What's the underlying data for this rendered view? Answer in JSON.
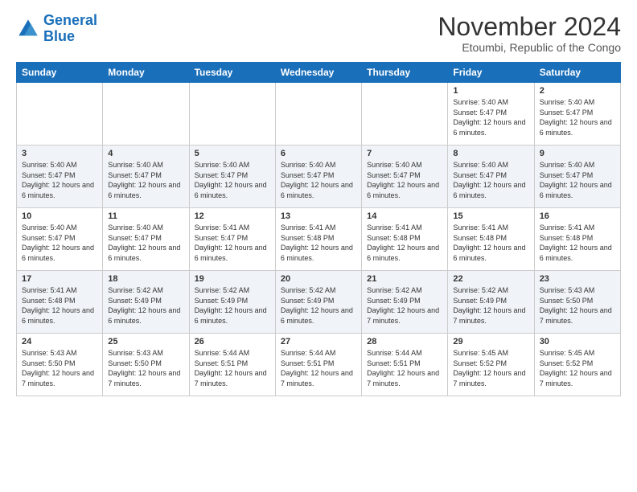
{
  "logo": {
    "line1": "General",
    "line2": "Blue"
  },
  "title": "November 2024",
  "location": "Etoumbi, Republic of the Congo",
  "days_of_week": [
    "Sunday",
    "Monday",
    "Tuesday",
    "Wednesday",
    "Thursday",
    "Friday",
    "Saturday"
  ],
  "weeks": [
    [
      {
        "day": "",
        "sunrise": "",
        "sunset": "",
        "daylight": ""
      },
      {
        "day": "",
        "sunrise": "",
        "sunset": "",
        "daylight": ""
      },
      {
        "day": "",
        "sunrise": "",
        "sunset": "",
        "daylight": ""
      },
      {
        "day": "",
        "sunrise": "",
        "sunset": "",
        "daylight": ""
      },
      {
        "day": "",
        "sunrise": "",
        "sunset": "",
        "daylight": ""
      },
      {
        "day": "1",
        "sunrise": "Sunrise: 5:40 AM",
        "sunset": "Sunset: 5:47 PM",
        "daylight": "Daylight: 12 hours and 6 minutes."
      },
      {
        "day": "2",
        "sunrise": "Sunrise: 5:40 AM",
        "sunset": "Sunset: 5:47 PM",
        "daylight": "Daylight: 12 hours and 6 minutes."
      }
    ],
    [
      {
        "day": "3",
        "sunrise": "Sunrise: 5:40 AM",
        "sunset": "Sunset: 5:47 PM",
        "daylight": "Daylight: 12 hours and 6 minutes."
      },
      {
        "day": "4",
        "sunrise": "Sunrise: 5:40 AM",
        "sunset": "Sunset: 5:47 PM",
        "daylight": "Daylight: 12 hours and 6 minutes."
      },
      {
        "day": "5",
        "sunrise": "Sunrise: 5:40 AM",
        "sunset": "Sunset: 5:47 PM",
        "daylight": "Daylight: 12 hours and 6 minutes."
      },
      {
        "day": "6",
        "sunrise": "Sunrise: 5:40 AM",
        "sunset": "Sunset: 5:47 PM",
        "daylight": "Daylight: 12 hours and 6 minutes."
      },
      {
        "day": "7",
        "sunrise": "Sunrise: 5:40 AM",
        "sunset": "Sunset: 5:47 PM",
        "daylight": "Daylight: 12 hours and 6 minutes."
      },
      {
        "day": "8",
        "sunrise": "Sunrise: 5:40 AM",
        "sunset": "Sunset: 5:47 PM",
        "daylight": "Daylight: 12 hours and 6 minutes."
      },
      {
        "day": "9",
        "sunrise": "Sunrise: 5:40 AM",
        "sunset": "Sunset: 5:47 PM",
        "daylight": "Daylight: 12 hours and 6 minutes."
      }
    ],
    [
      {
        "day": "10",
        "sunrise": "Sunrise: 5:40 AM",
        "sunset": "Sunset: 5:47 PM",
        "daylight": "Daylight: 12 hours and 6 minutes."
      },
      {
        "day": "11",
        "sunrise": "Sunrise: 5:40 AM",
        "sunset": "Sunset: 5:47 PM",
        "daylight": "Daylight: 12 hours and 6 minutes."
      },
      {
        "day": "12",
        "sunrise": "Sunrise: 5:41 AM",
        "sunset": "Sunset: 5:47 PM",
        "daylight": "Daylight: 12 hours and 6 minutes."
      },
      {
        "day": "13",
        "sunrise": "Sunrise: 5:41 AM",
        "sunset": "Sunset: 5:48 PM",
        "daylight": "Daylight: 12 hours and 6 minutes."
      },
      {
        "day": "14",
        "sunrise": "Sunrise: 5:41 AM",
        "sunset": "Sunset: 5:48 PM",
        "daylight": "Daylight: 12 hours and 6 minutes."
      },
      {
        "day": "15",
        "sunrise": "Sunrise: 5:41 AM",
        "sunset": "Sunset: 5:48 PM",
        "daylight": "Daylight: 12 hours and 6 minutes."
      },
      {
        "day": "16",
        "sunrise": "Sunrise: 5:41 AM",
        "sunset": "Sunset: 5:48 PM",
        "daylight": "Daylight: 12 hours and 6 minutes."
      }
    ],
    [
      {
        "day": "17",
        "sunrise": "Sunrise: 5:41 AM",
        "sunset": "Sunset: 5:48 PM",
        "daylight": "Daylight: 12 hours and 6 minutes."
      },
      {
        "day": "18",
        "sunrise": "Sunrise: 5:42 AM",
        "sunset": "Sunset: 5:49 PM",
        "daylight": "Daylight: 12 hours and 6 minutes."
      },
      {
        "day": "19",
        "sunrise": "Sunrise: 5:42 AM",
        "sunset": "Sunset: 5:49 PM",
        "daylight": "Daylight: 12 hours and 6 minutes."
      },
      {
        "day": "20",
        "sunrise": "Sunrise: 5:42 AM",
        "sunset": "Sunset: 5:49 PM",
        "daylight": "Daylight: 12 hours and 6 minutes."
      },
      {
        "day": "21",
        "sunrise": "Sunrise: 5:42 AM",
        "sunset": "Sunset: 5:49 PM",
        "daylight": "Daylight: 12 hours and 7 minutes."
      },
      {
        "day": "22",
        "sunrise": "Sunrise: 5:42 AM",
        "sunset": "Sunset: 5:49 PM",
        "daylight": "Daylight: 12 hours and 7 minutes."
      },
      {
        "day": "23",
        "sunrise": "Sunrise: 5:43 AM",
        "sunset": "Sunset: 5:50 PM",
        "daylight": "Daylight: 12 hours and 7 minutes."
      }
    ],
    [
      {
        "day": "24",
        "sunrise": "Sunrise: 5:43 AM",
        "sunset": "Sunset: 5:50 PM",
        "daylight": "Daylight: 12 hours and 7 minutes."
      },
      {
        "day": "25",
        "sunrise": "Sunrise: 5:43 AM",
        "sunset": "Sunset: 5:50 PM",
        "daylight": "Daylight: 12 hours and 7 minutes."
      },
      {
        "day": "26",
        "sunrise": "Sunrise: 5:44 AM",
        "sunset": "Sunset: 5:51 PM",
        "daylight": "Daylight: 12 hours and 7 minutes."
      },
      {
        "day": "27",
        "sunrise": "Sunrise: 5:44 AM",
        "sunset": "Sunset: 5:51 PM",
        "daylight": "Daylight: 12 hours and 7 minutes."
      },
      {
        "day": "28",
        "sunrise": "Sunrise: 5:44 AM",
        "sunset": "Sunset: 5:51 PM",
        "daylight": "Daylight: 12 hours and 7 minutes."
      },
      {
        "day": "29",
        "sunrise": "Sunrise: 5:45 AM",
        "sunset": "Sunset: 5:52 PM",
        "daylight": "Daylight: 12 hours and 7 minutes."
      },
      {
        "day": "30",
        "sunrise": "Sunrise: 5:45 AM",
        "sunset": "Sunset: 5:52 PM",
        "daylight": "Daylight: 12 hours and 7 minutes."
      }
    ]
  ]
}
